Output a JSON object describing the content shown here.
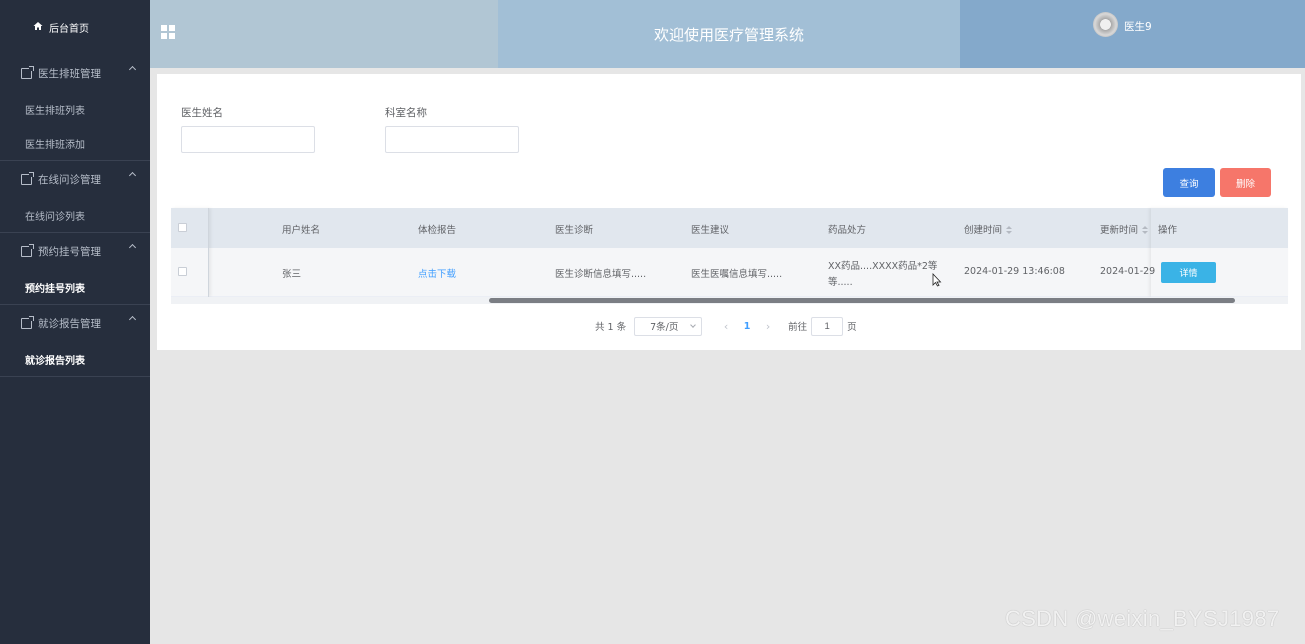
{
  "sidebar": {
    "home_label": "后台首页",
    "groups": [
      {
        "title": "医生排班管理",
        "items": [
          {
            "label": "医生排班列表"
          },
          {
            "label": "医生排班添加"
          }
        ]
      },
      {
        "title": "在线问诊管理",
        "items": [
          {
            "label": "在线问诊列表"
          }
        ]
      },
      {
        "title": "预约挂号管理",
        "items": [
          {
            "label": "预约挂号列表"
          }
        ]
      },
      {
        "title": "就诊报告管理",
        "items": [
          {
            "label": "就诊报告列表"
          }
        ]
      }
    ]
  },
  "header": {
    "title": "欢迎使用医疗管理系统",
    "user_name": "医生9"
  },
  "search": {
    "doctor_name_label": "医生姓名",
    "doctor_name_value": "",
    "department_label": "科室名称",
    "department_value": "",
    "query_button": "查询",
    "delete_button": "删除"
  },
  "table": {
    "columns": [
      "用户姓名",
      "体检报告",
      "医生诊断",
      "医生建议",
      "药品处方",
      "创建时间",
      "更新时间",
      "操作"
    ],
    "rows": [
      {
        "user_name": "张三",
        "report": "点击下载",
        "diagnosis": "医生诊断信息填写.....",
        "advice": "医生医嘱信息填写.....",
        "prescription_line1": "XX药品....XXXX药品*2等",
        "prescription_line2": "等.....",
        "created_at": "2024-01-29 13:46:08",
        "updated_at": "2024-01-29",
        "detail_button": "详情"
      }
    ]
  },
  "pagination": {
    "total_text": "共 1 条",
    "page_size": "7条/页",
    "prev": "‹",
    "current_page": "1",
    "next": "›",
    "goto_label": "前往",
    "goto_value": "1",
    "page_unit": "页"
  },
  "watermark": "CSDN @weixin_BYSJ1987",
  "colors": {
    "sidebar_bg": "#262e3d",
    "primary": "#3d7fe0",
    "danger": "#f6766a",
    "info": "#3ab3e6",
    "link": "#409eff"
  }
}
